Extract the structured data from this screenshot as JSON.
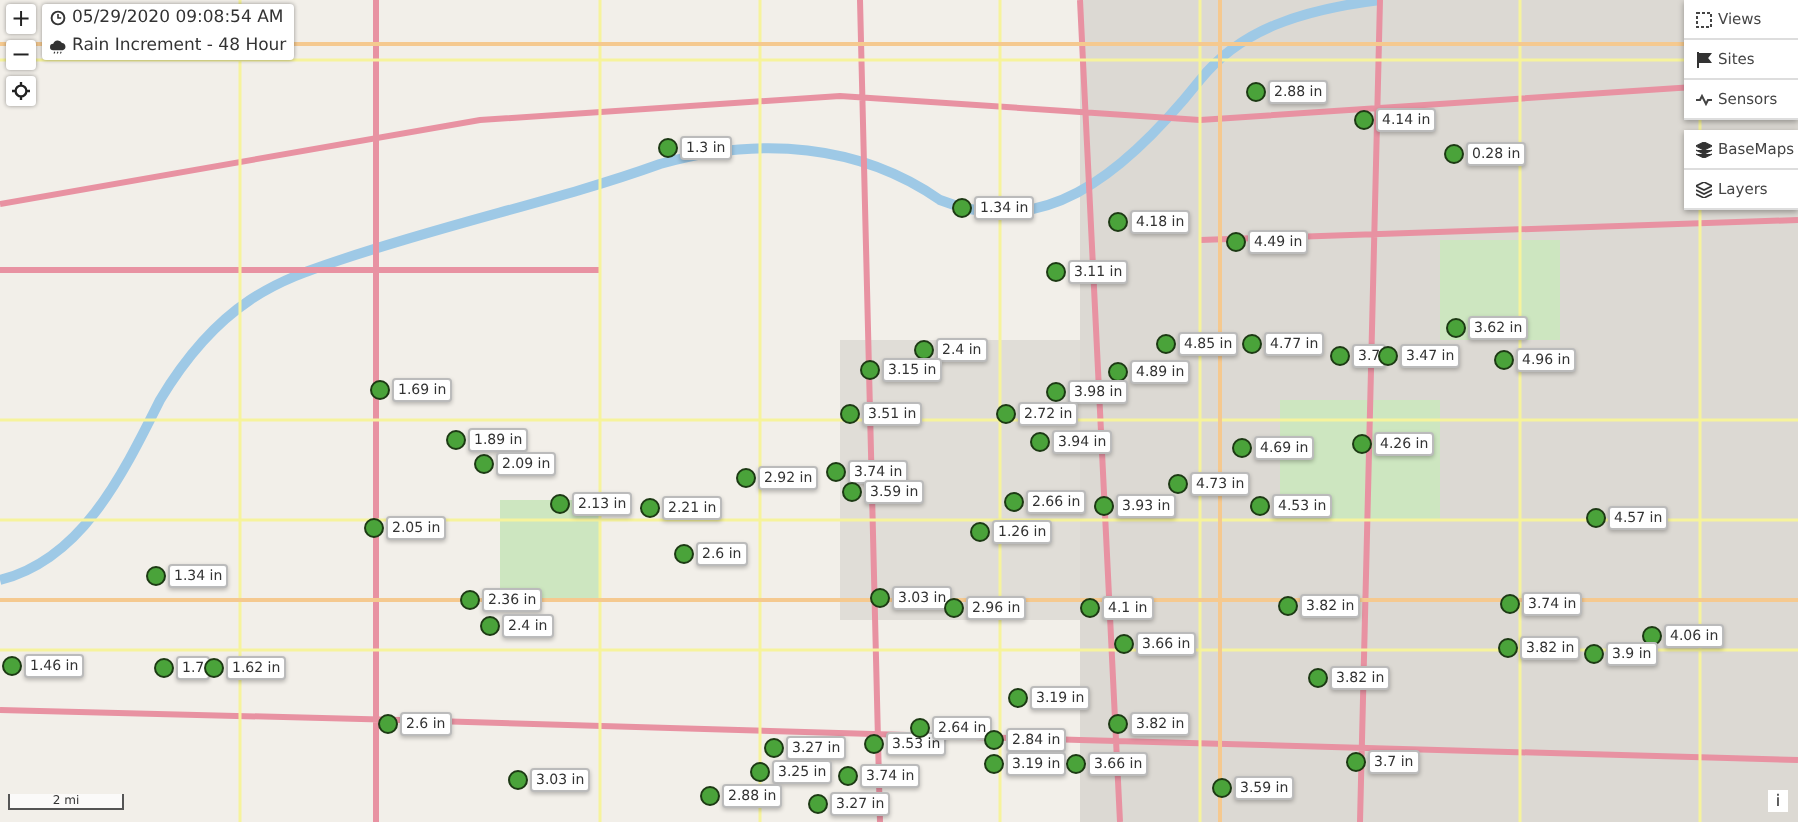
{
  "zoom_controls": [
    "+",
    "−"
  ],
  "info": {
    "timestamp": "05/29/2020 09:08:54 AM",
    "layer": "Rain Increment - 48 Hour"
  },
  "menu": {
    "groups": [
      [
        {
          "label": "Views"
        },
        {
          "label": "Sites"
        },
        {
          "label": "Sensors"
        }
      ],
      [
        {
          "label": "BaseMaps"
        },
        {
          "label": "Layers"
        }
      ]
    ]
  },
  "gauges": [
    {
      "reading": "1.3 in"
    },
    {
      "reading": "1.34 in"
    },
    {
      "reading": "4.18 in"
    },
    {
      "reading": "3.11 in"
    },
    {
      "reading": "2.88 in"
    },
    {
      "reading": "4.14 in"
    },
    {
      "reading": "0.28 in"
    },
    {
      "reading": "4.49 in"
    },
    {
      "reading": "3.62 in"
    },
    {
      "reading": "4.96 in"
    },
    {
      "reading": "4.85 in"
    },
    {
      "reading": "4.77 in"
    },
    {
      "reading": "3.7"
    },
    {
      "reading": "3.47 in"
    },
    {
      "reading": "2.4 in"
    },
    {
      "reading": "3.15 in"
    },
    {
      "reading": "4.89 in"
    },
    {
      "reading": "3.98 in"
    },
    {
      "reading": "1.69 in"
    },
    {
      "reading": "3.51 in"
    },
    {
      "reading": "2.72 in"
    },
    {
      "reading": "1.89 in"
    },
    {
      "reading": "2.09 in"
    },
    {
      "reading": "3.94 in"
    },
    {
      "reading": "4.69 in"
    },
    {
      "reading": "4.26 in"
    },
    {
      "reading": "3.74 in"
    },
    {
      "reading": "2.92 in"
    },
    {
      "reading": "3.59 in"
    },
    {
      "reading": "4.73 in"
    },
    {
      "reading": "2.13 in"
    },
    {
      "reading": "2.21 in"
    },
    {
      "reading": "2.66 in"
    },
    {
      "reading": "3.93 in"
    },
    {
      "reading": "1.26 in"
    },
    {
      "reading": "4.53 in"
    },
    {
      "reading": "4.57 in"
    },
    {
      "reading": "2.05 in"
    },
    {
      "reading": "2.6 in"
    },
    {
      "reading": "1.34 in"
    },
    {
      "reading": "3.03 in"
    },
    {
      "reading": "2.96 in"
    },
    {
      "reading": "2.36 in"
    },
    {
      "reading": "4.1 in"
    },
    {
      "reading": "3.82 in"
    },
    {
      "reading": "3.74 in"
    },
    {
      "reading": "2.4 in"
    },
    {
      "reading": "3.66 in"
    },
    {
      "reading": "4.06 in"
    },
    {
      "reading": "3.82 in"
    },
    {
      "reading": "3.9 in"
    },
    {
      "reading": "1.46 in"
    },
    {
      "reading": "1.7"
    },
    {
      "reading": "1.62 in"
    },
    {
      "reading": "3.82 in"
    },
    {
      "reading": "3.19 in"
    },
    {
      "reading": "2.6 in"
    },
    {
      "reading": "3.27 in"
    },
    {
      "reading": "3.53 in"
    },
    {
      "reading": "2.64 in"
    },
    {
      "reading": "2.84 in"
    },
    {
      "reading": "3.82 in"
    },
    {
      "reading": "3.03 in"
    },
    {
      "reading": "3.25 in"
    },
    {
      "reading": "3.74 in"
    },
    {
      "reading": "3.19 in"
    },
    {
      "reading": "3.66 in"
    },
    {
      "reading": "3.7 in"
    },
    {
      "reading": "2.88 in"
    },
    {
      "reading": "3.27 in"
    },
    {
      "reading": "3.59 in"
    }
  ],
  "scale": "2 mi",
  "info_button": "i"
}
